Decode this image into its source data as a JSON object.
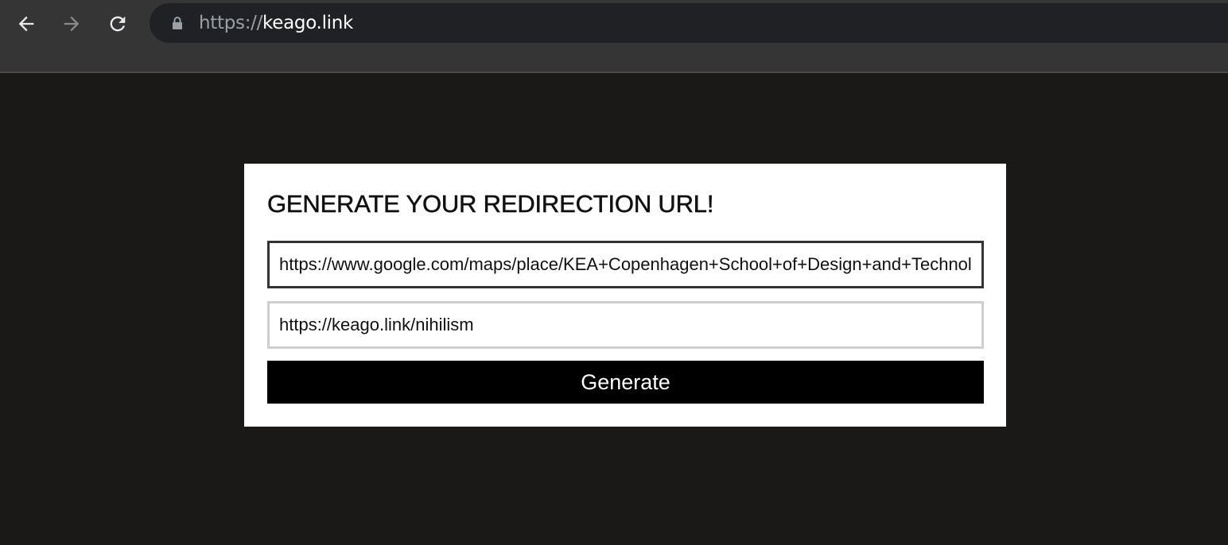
{
  "browser": {
    "url_scheme": "https://",
    "url_host": "keago.link",
    "back_icon": "arrow-left-icon",
    "forward_icon": "arrow-right-icon",
    "reload_icon": "reload-icon",
    "lock_icon": "lock-icon"
  },
  "form": {
    "title": "GENERATE YOUR REDIRECTION URL!",
    "target_url_value": "https://www.google.com/maps/place/KEA+Copenhagen+School+of+Design+and+Technology",
    "short_url_value": "https://keago.link/nihilism",
    "generate_label": "Generate"
  },
  "colors": {
    "page_background": "#1a1917",
    "toolbar": "#353535",
    "card": "#ffffff",
    "button": "#000000"
  }
}
